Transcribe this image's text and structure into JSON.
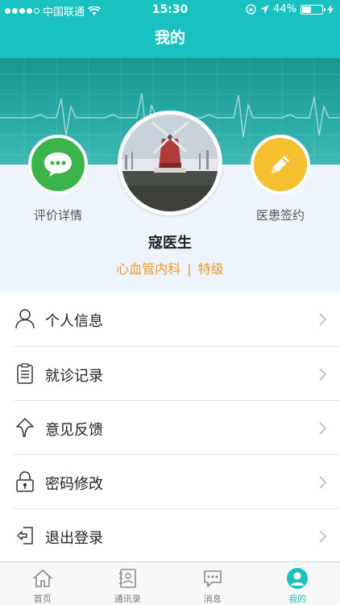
{
  "status_bar": {
    "carrier": "中国联通",
    "time": "15:30",
    "battery": "44%"
  },
  "header": {
    "title": "我的"
  },
  "profile": {
    "name": "寇医生",
    "department": "心血管内科",
    "separator": "|",
    "level": "特级",
    "left_action": {
      "label": "评价详情",
      "icon": "comment-bubble-icon",
      "color": "#3cb44b"
    },
    "right_action": {
      "label": "医患签约",
      "icon": "pencil-icon",
      "color": "#f5c02f"
    }
  },
  "menu": {
    "items": [
      {
        "label": "个人信息",
        "icon": "person-icon"
      },
      {
        "label": "就诊记录",
        "icon": "clipboard-icon"
      },
      {
        "label": "意见反馈",
        "icon": "feedback-arrow-icon"
      },
      {
        "label": "密码修改",
        "icon": "lock-icon"
      },
      {
        "label": "退出登录",
        "icon": "logout-icon"
      }
    ]
  },
  "tabs": {
    "items": [
      {
        "label": "首页",
        "icon": "home-icon"
      },
      {
        "label": "通讯录",
        "icon": "contacts-icon"
      },
      {
        "label": "消息",
        "icon": "message-icon"
      },
      {
        "label": "我的",
        "icon": "profile-icon",
        "active": true
      }
    ]
  },
  "colors": {
    "accent": "#19c2c0",
    "orange": "#f0962a"
  }
}
